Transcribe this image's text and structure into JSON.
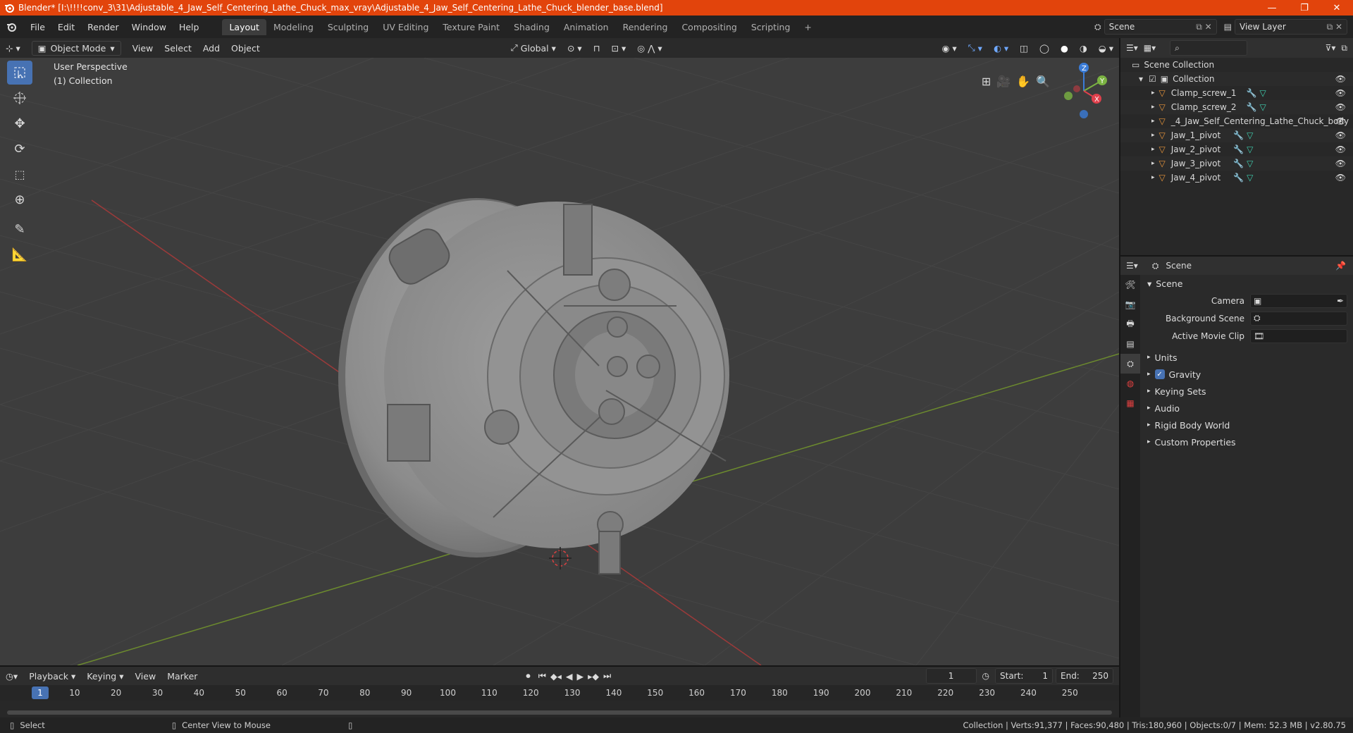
{
  "window": {
    "title": "Blender* [I:\\!!!!conv_3\\31\\Adjustable_4_Jaw_Self_Centering_Lathe_Chuck_max_vray\\Adjustable_4_Jaw_Self_Centering_Lathe_Chuck_blender_base.blend]",
    "minimize": "—",
    "maximize": "❐",
    "close": "✕"
  },
  "menu": [
    "File",
    "Edit",
    "Render",
    "Window",
    "Help"
  ],
  "workspaces": [
    "Layout",
    "Modeling",
    "Sculpting",
    "UV Editing",
    "Texture Paint",
    "Shading",
    "Animation",
    "Rendering",
    "Compositing",
    "Scripting"
  ],
  "active_workspace": "Layout",
  "scene_field": "Scene",
  "view_layer_field": "View Layer",
  "viewport": {
    "mode": "Object Mode",
    "menus": [
      "View",
      "Select",
      "Add",
      "Object"
    ],
    "transform_orientation": "Global",
    "info_line1": "User Perspective",
    "info_line2": "(1) Collection",
    "gizmo_z": "Z",
    "gizmo_y": "Y",
    "gizmo_x": "X"
  },
  "outliner": {
    "scene_collection": "Scene Collection",
    "collection": "Collection",
    "objects": [
      "Clamp_screw_1",
      "Clamp_screw_2",
      "_4_Jaw_Self_Centering_Lathe_Chuck_body",
      "Jaw_1_pivot",
      "Jaw_2_pivot",
      "Jaw_3_pivot",
      "Jaw_4_pivot"
    ]
  },
  "properties": {
    "header": "Scene",
    "section": "Scene",
    "camera_label": "Camera",
    "background_scene_label": "Background Scene",
    "active_movie_clip_label": "Active Movie Clip",
    "panels": [
      "Units",
      "Gravity",
      "Keying Sets",
      "Audio",
      "Rigid Body World",
      "Custom Properties"
    ],
    "gravity_checked": true
  },
  "timeline": {
    "menus": [
      "Playback",
      "Keying",
      "View",
      "Marker"
    ],
    "current_frame": "1",
    "start_label": "Start:",
    "start": "1",
    "end_label": "End:",
    "end": "250",
    "ticks": [
      "10",
      "20",
      "30",
      "40",
      "50",
      "60",
      "70",
      "80",
      "90",
      "100",
      "110",
      "120",
      "130",
      "140",
      "150",
      "160",
      "170",
      "180",
      "190",
      "200",
      "210",
      "220",
      "230",
      "240",
      "250"
    ]
  },
  "status": {
    "select": "Select",
    "center_view": "Center View to Mouse",
    "stats": "Collection | Verts:91,377 | Faces:90,480 | Tris:180,960 | Objects:0/7 | Mem: 52.3 MB | v2.80.75"
  },
  "colors": {
    "accent": "#4772b3",
    "titlebar": "#e2440c",
    "object_icon": "#e8953a",
    "modifier_icon": "#6fa8ff",
    "mesh_icon": "#3fd0b0"
  }
}
